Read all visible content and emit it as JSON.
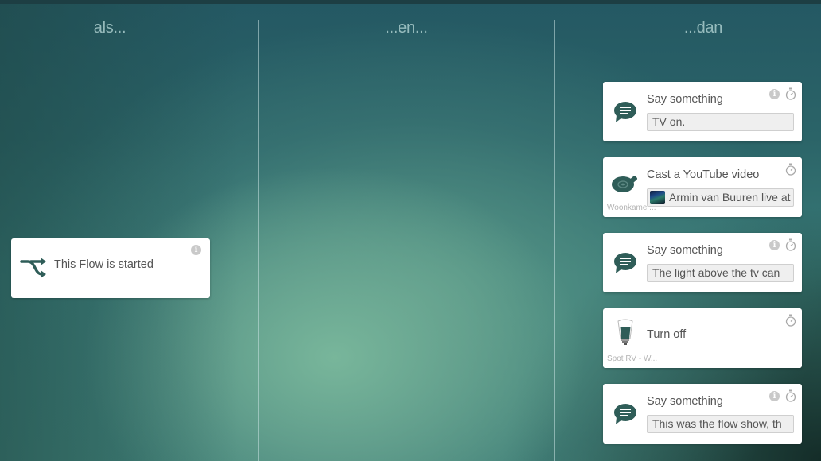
{
  "columns": [
    {
      "title": "als..."
    },
    {
      "title": "...en..."
    },
    {
      "title": "...dan"
    }
  ],
  "colors": {
    "accent": "#2f5d58",
    "card_bg": "#ffffff",
    "field_bg": "#efefef",
    "muted_icon": "#c9c9c9"
  },
  "triggers": [
    {
      "title": "This Flow is started",
      "icon": "flow-start-icon",
      "has_info": true
    }
  ],
  "actions": [
    {
      "title": "Say something",
      "value": "TV on.",
      "icon": "speech-bubble-icon",
      "has_info": true,
      "has_delay": true
    },
    {
      "title": "Cast a YouTube video",
      "value": "Armin van Buuren live at To",
      "device": "Woonkamer...",
      "icon": "chromecast-icon",
      "has_info": false,
      "has_delay": true
    },
    {
      "title": "Say something",
      "value": "The light above the tv can",
      "icon": "speech-bubble-icon",
      "has_info": true,
      "has_delay": true
    },
    {
      "title": "Turn off",
      "device": "Spot RV - W...",
      "icon": "light-bulb-icon",
      "has_info": false,
      "has_delay": true
    },
    {
      "title": "Say something",
      "value": "This was the flow show, th",
      "icon": "speech-bubble-icon",
      "has_info": true,
      "has_delay": true
    }
  ],
  "glyphs": {
    "info": "i"
  }
}
